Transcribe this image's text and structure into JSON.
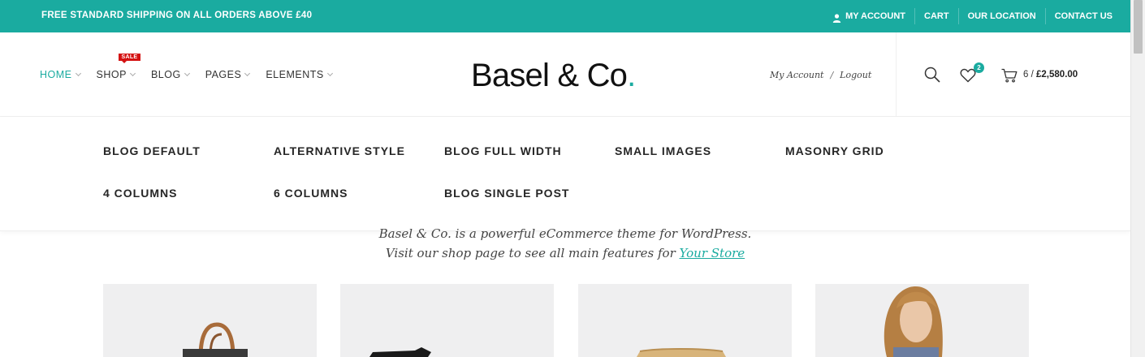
{
  "topbar": {
    "promo": "FREE STANDARD SHIPPING ON ALL ORDERS ABOVE £40",
    "links": {
      "my_account": "MY ACCOUNT",
      "cart": "CART",
      "our_location": "OUR LOCATION",
      "contact_us": "CONTACT US"
    },
    "bg_color": "#1aaba0"
  },
  "nav": {
    "items": [
      {
        "label": "HOME",
        "active": true
      },
      {
        "label": "SHOP",
        "badge": "SALE"
      },
      {
        "label": "BLOG"
      },
      {
        "label": "PAGES"
      },
      {
        "label": "ELEMENTS"
      }
    ]
  },
  "logo": {
    "text": "Basel & Co",
    "dot": "."
  },
  "account": {
    "my_account": "My Account",
    "separator": "/",
    "logout": "Logout"
  },
  "header_icons": {
    "search": "search-icon",
    "wishlist": "heart-icon",
    "wishlist_count": "2",
    "cart": "cart-icon",
    "cart_count": "6",
    "cart_separator": "/",
    "cart_total": "£2,580.00"
  },
  "blog_dropdown": {
    "items": [
      "BLOG DEFAULT",
      "ALTERNATIVE STYLE",
      "BLOG FULL WIDTH",
      "SMALL IMAGES",
      "MASONRY GRID",
      "4 COLUMNS",
      "6 COLUMNS",
      "BLOG SINGLE POST"
    ]
  },
  "intro": {
    "line1": "Basel & Co. is a powerful eCommerce theme for WordPress.",
    "line2_prefix": "Visit our shop page to see all main features for ",
    "line2_link": "Your Store"
  },
  "products": [
    {
      "image": "leather-bag"
    },
    {
      "image": "black-item"
    },
    {
      "image": "straw-hat"
    },
    {
      "image": "model-woman"
    }
  ],
  "accent_color": "#1aaba0",
  "sale_color": "#d41212"
}
